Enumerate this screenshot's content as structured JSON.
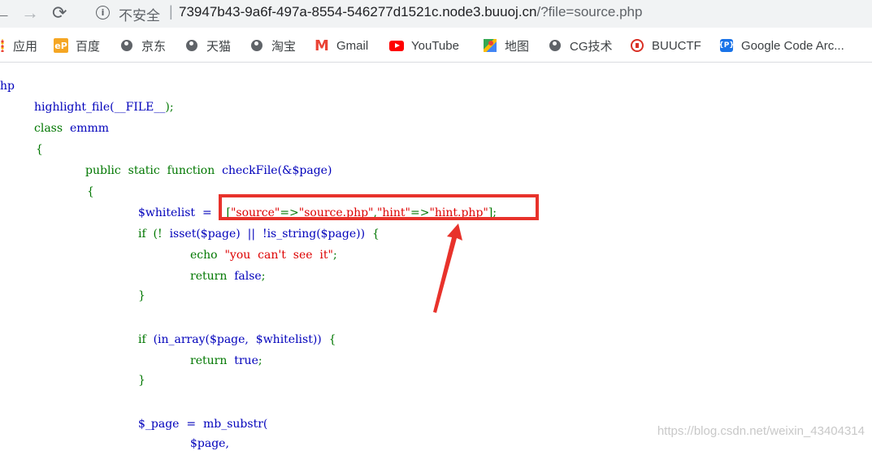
{
  "browser": {
    "security_label": "不安全",
    "separator": "|",
    "url_host": "73947b43-9a6f-497a-8554-546277d1521c.node3.buuoj.cn",
    "url_path": "/?file=source.php"
  },
  "bookmarks": [
    {
      "label": "应用",
      "icon": "apps-icon"
    },
    {
      "label": "百度",
      "icon": "baidu-icon"
    },
    {
      "label": "京东",
      "icon": "globe-icon"
    },
    {
      "label": "天猫",
      "icon": "globe-icon"
    },
    {
      "label": "淘宝",
      "icon": "globe-icon"
    },
    {
      "label": "Gmail",
      "icon": "gmail-icon"
    },
    {
      "label": "YouTube",
      "icon": "youtube-icon"
    },
    {
      "label": "地图",
      "icon": "maps-icon"
    },
    {
      "label": "CG技术",
      "icon": "globe-icon"
    },
    {
      "label": "BUUCTF",
      "icon": "buuctf-icon"
    },
    {
      "label": "Google Code Arc...",
      "icon": "google-code-icon"
    }
  ],
  "code": {
    "line1": "hp",
    "line2_fn": "highlight_file(",
    "line2_const": "__FILE__",
    "line2_end": ");",
    "line3_kw": "class",
    "line3_name": "emmm",
    "brace_open": "{",
    "brace_close": "}",
    "line5_kw": "public  static  function",
    "line5_fn": "checkFile(&$page)",
    "line7_var": "$whitelist  =",
    "line7_arr_open": "[",
    "line7_s1": "\"source\"",
    "line7_arrow": "=>",
    "line7_s2": "\"source.php\"",
    "line7_comma": ",",
    "line7_s3": "\"hint\"",
    "line7_s4": "\"hint.php\"",
    "line7_end": "];",
    "line8_kw": "if  (!  ",
    "line8_fn": "isset($page)  ||  !is_string($page))",
    "line8_brace": "  {",
    "line9_kw": "echo",
    "line9_str": "\"you  can't  see  it\"",
    "line9_end": ";",
    "line10_kw": "return  ",
    "line10_val": "false",
    "semicolon": ";",
    "line13_kw": "if  ",
    "line13_fn": "(in_array($page,  $whitelist))",
    "line14_val": "true",
    "line17_var": "$_page  =  mb_substr(",
    "line18_var": "$page,"
  },
  "watermark": "https://blog.csdn.net/weixin_43404314",
  "colors": {
    "keyword": "#007700",
    "default": "#0000bb",
    "string": "#dd0000",
    "annotation": "#e8322b"
  }
}
